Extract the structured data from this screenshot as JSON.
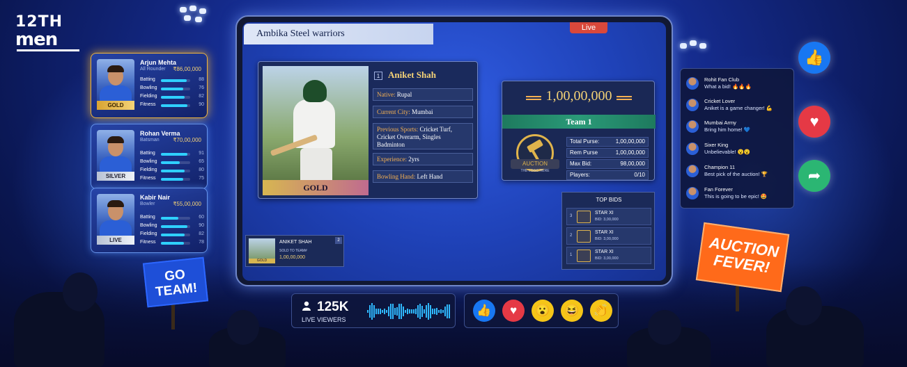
{
  "brand": {
    "line1": "12TH",
    "line2": "men"
  },
  "player_cards": [
    {
      "name": "Arjun Mehta",
      "role": "All Rounder",
      "price": "₹86,00,000",
      "tier": "GOLD",
      "stats": [
        {
          "label": "Batting",
          "value": "88"
        },
        {
          "label": "Bowling",
          "value": "76"
        },
        {
          "label": "Fielding",
          "value": "82"
        },
        {
          "label": "Fitness",
          "value": "90"
        }
      ]
    },
    {
      "name": "Rohan Verma",
      "role": "Batsman",
      "price": "₹70,00,000",
      "tier": "SILVER",
      "stats": [
        {
          "label": "Batting",
          "value": "91"
        },
        {
          "label": "Bowling",
          "value": "65"
        },
        {
          "label": "Fielding",
          "value": "80"
        },
        {
          "label": "Fitness",
          "value": "75"
        }
      ]
    },
    {
      "name": "Kabir Nair",
      "role": "Bowler",
      "price": "₹55,00,000",
      "tier": "LIVE",
      "stats": [
        {
          "label": "Batting",
          "value": "60"
        },
        {
          "label": "Bowling",
          "value": "90"
        },
        {
          "label": "Fielding",
          "value": "82"
        },
        {
          "label": "Fitness",
          "value": "78"
        }
      ]
    }
  ],
  "auction": {
    "team_banner": "Ambika Steel warriors",
    "live_label": "Live",
    "player": {
      "number": "1",
      "name": "Aniket Shah",
      "tier": "GOLD",
      "fields": [
        {
          "key": "Native:",
          "value": "Rupal"
        },
        {
          "key": "Current City:",
          "value": "Mumbai"
        },
        {
          "key": "Previous Sports:",
          "value": "Cricket Turf, Cricket Overarm, Singles Badminton"
        },
        {
          "key": "Experience:",
          "value": "2yrs"
        },
        {
          "key": "Bowling Hand:",
          "value": "Left Hand"
        }
      ]
    },
    "bid": {
      "amount": "1,00,00,000",
      "team": "Team 1",
      "logo_text": "AUCTION",
      "logo_sub": "THE LOGO HERE",
      "rows": [
        {
          "key": "Total Purse:",
          "value": "1,00,00,000"
        },
        {
          "key": "Rem Purse",
          "value": "1,00,00,000"
        },
        {
          "key": "Max Bid:",
          "value": "98,00,000"
        },
        {
          "key": "Players:",
          "value": "0/10"
        }
      ]
    },
    "top_bids": {
      "title": "TOP BIDS",
      "rows": [
        {
          "rank": "3",
          "team": "STAR XI",
          "bid": "BID: 3,00,000"
        },
        {
          "rank": "2",
          "team": "STAR XI",
          "bid": "BID: 3,00,000"
        },
        {
          "rank": "1",
          "team": "STAR XI",
          "bid": "BID: 3,00,000"
        }
      ]
    },
    "sold": {
      "name": "ANIKET SHAH",
      "label": "SOLD TO TEAM#",
      "price": "1,00,00,000",
      "number": "2",
      "tier": "GOLD"
    }
  },
  "comments": [
    {
      "user": "Rohit Fan Club",
      "text": "What a bid! 🔥🔥🔥"
    },
    {
      "user": "Cricket Lover",
      "text": "Aniket is a game changer! 💪"
    },
    {
      "user": "Mumbai Army",
      "text": "Bring him home! 💙"
    },
    {
      "user": "Sixer King",
      "text": "Unbelievable! 😮😮"
    },
    {
      "user": "Champion 11",
      "text": "Best pick of the auction! 🏆"
    },
    {
      "user": "Fan Forever",
      "text": "This is going to be epic! 🤩"
    }
  ],
  "viewers": {
    "count": "125K",
    "label": "LIVE VIEWERS"
  },
  "signs": {
    "left": "GO TEAM!",
    "right": "AUCTION FEVER!"
  },
  "colors": {
    "accent": "#f4d276",
    "live": "#d9483b",
    "team": "#2a9a78",
    "like": "#1877f2",
    "heart": "#e53945",
    "share": "#2bb673",
    "fever": "#ff6a1a"
  },
  "icons": {
    "like": "thumbs-up-icon",
    "heart": "heart-icon",
    "share": "share-arrow-icon",
    "wow": "wow-face-icon",
    "laugh": "laugh-face-icon",
    "clap": "clap-icon"
  }
}
